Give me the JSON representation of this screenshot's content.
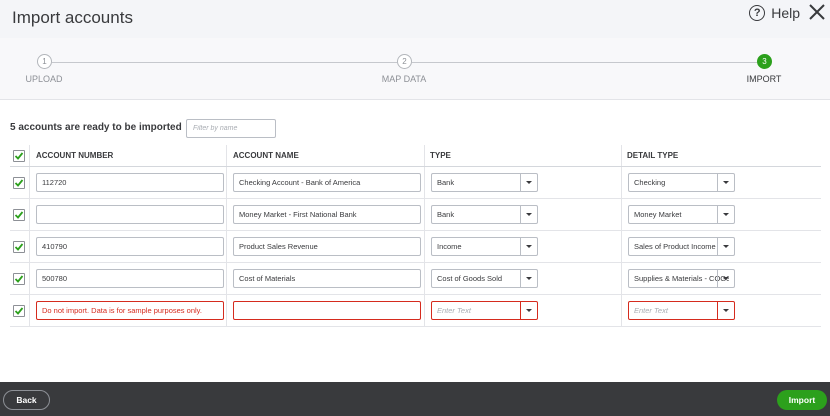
{
  "header": {
    "title": "Import accounts",
    "help_icon_glyph": "?",
    "help_label": "Help"
  },
  "stepper": {
    "steps": [
      {
        "number": "1",
        "label": "UPLOAD",
        "active": false
      },
      {
        "number": "2",
        "label": "MAP DATA",
        "active": false
      },
      {
        "number": "3",
        "label": "IMPORT",
        "active": true
      }
    ]
  },
  "main": {
    "ready_text": "5 accounts are ready to be imported",
    "filter_placeholder": "Filter by name",
    "columns": {
      "account_number": "ACCOUNT NUMBER",
      "account_name": "ACCOUNT NAME",
      "type": "TYPE",
      "detail_type": "DETAIL TYPE"
    },
    "rows": [
      {
        "checked": true,
        "account_number": "112720",
        "account_name": "Checking Account - Bank of America",
        "type": "Bank",
        "detail_type": "Checking"
      },
      {
        "checked": true,
        "account_number": "",
        "account_name": "Money Market - First National Bank",
        "type": "Bank",
        "detail_type": "Money Market"
      },
      {
        "checked": true,
        "account_number": "410790",
        "account_name": "Product Sales Revenue",
        "type": "Income",
        "detail_type": "Sales of Product Income"
      },
      {
        "checked": true,
        "account_number": "500780",
        "account_name": "Cost of Materials",
        "type": "Cost of Goods Sold",
        "detail_type": "Supplies & Materials - COGS"
      },
      {
        "checked": true,
        "account_number": "Do not import. Data is for sample purposes only.",
        "account_name": "",
        "type": "Enter Text",
        "detail_type": "Enter Text",
        "error": true
      }
    ]
  },
  "footer": {
    "back_label": "Back",
    "import_label": "Import"
  },
  "colors": {
    "accent_green": "#2ca01c",
    "error_red": "#d52b1e",
    "footer_bg": "#393a3d"
  },
  "icons": {
    "help": "question-circle-icon",
    "close": "close-icon",
    "checkbox": "checkmark-icon",
    "dropdown": "caret-down-icon"
  }
}
